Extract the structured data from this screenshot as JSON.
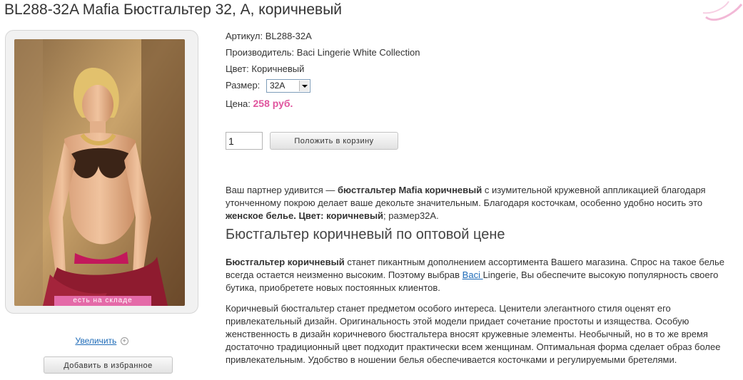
{
  "product": {
    "title": "BL288-32A Mafia Бюстгальтер 32, A, коричневый",
    "stock_badge": "есть на складе",
    "zoom_label": "Увеличить",
    "favorite_label": "Добавить в избранное"
  },
  "details": {
    "article_label": "Артикул:",
    "article_value": "BL288-32A",
    "manufacturer_label": "Производитель:",
    "manufacturer_value": "Baci Lingerie White Collection",
    "color_label": "Цвет:",
    "color_value": "Коричневый",
    "size_label": "Размер:",
    "size_selected": "32A",
    "price_label": "Цена:",
    "price_value": "258 руб."
  },
  "cart": {
    "quantity": "1",
    "add_label": "Положить в корзину"
  },
  "description": {
    "p1": {
      "a": "Ваш партнер удивится — ",
      "b": "бюстгальтер Mafia коричневый",
      "c": " с изумительной кружевной аппликацией благодаря утонченному покрою делает ваше декольте значительным. Благодаря косточкам, особенно удобно носить это ",
      "d": "женское белье. Цвет: коричневый",
      "e": "; размер32A."
    },
    "heading": "Бюстгальтер коричневый по оптовой цене",
    "p2": {
      "a": "Бюстгальтер коричневый",
      "b": " станет пикантным дополнением ассортимента Вашего магазина. Спрос на такое белье всегда остается неизменно высоким. Поэтому выбрав ",
      "link": "Baci ",
      "c": "Lingerie, Вы обеспечите высокую популярность своего бутика, приобретете новых постоянных клиентов."
    },
    "p3": "Коричневый бюстгальтер станет предметом особого интереса. Ценители элегантного стиля оценят его привлекательный дизайн. Оригинальность этой модели придает сочетание простоты и изящества. Особую женственность в дизайн коричневого бюстгальтера вносят кружевные элементы. Необычный, но в то же время достаточно традиционный цвет подходит практически всем женщинам. Оптимальная форма сделает образ более привлекательным. Удобство в ношении белья обеспечивается косточками и регулируемыми бретелями."
  },
  "colors": {
    "price": "#e0559e",
    "badge": "#e46aa8",
    "link": "#1e6bb8"
  }
}
